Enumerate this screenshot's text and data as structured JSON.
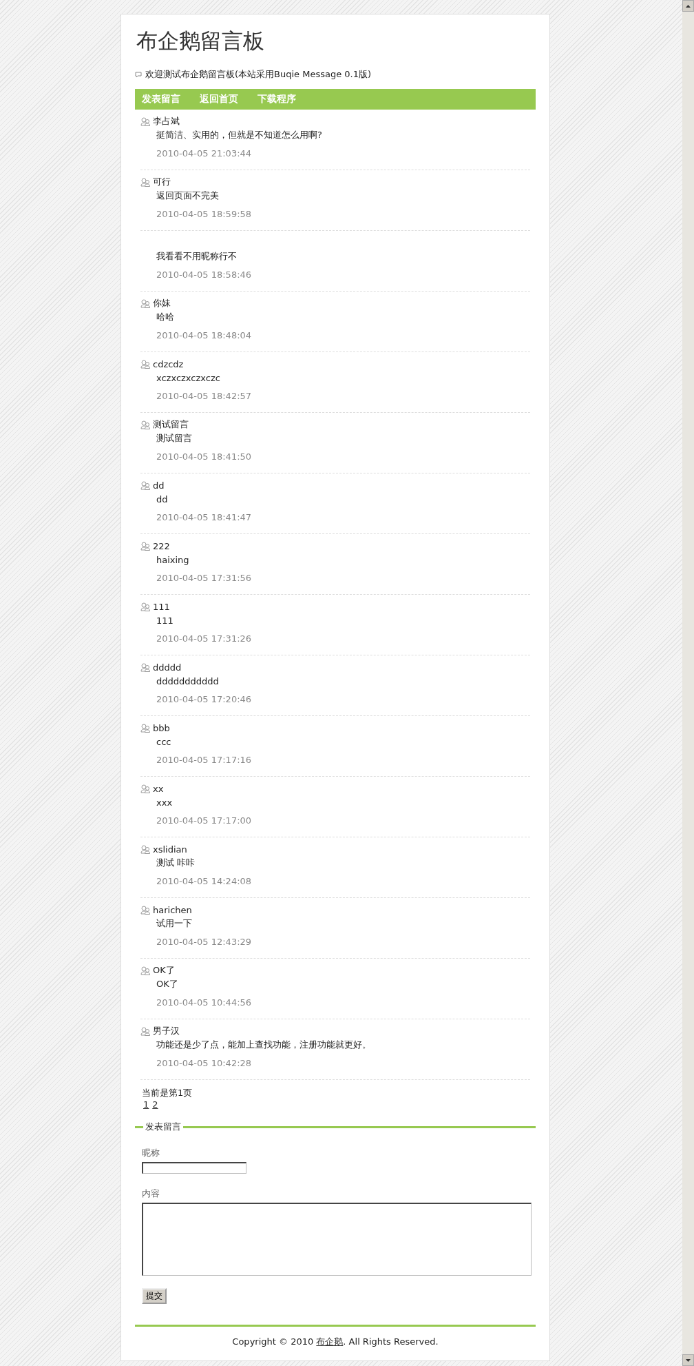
{
  "header": {
    "title": "布企鹅留言板",
    "welcome": "欢迎测试布企鹅留言板(本站采用Buqie Message 0.1版)"
  },
  "nav": [
    "发表留言",
    "返回首页",
    "下载程序"
  ],
  "messages": [
    {
      "name": "李占斌",
      "content": "挺简洁、实用的，但就是不知道怎么用啊?",
      "time": "2010-04-05 21:03:44"
    },
    {
      "name": "可行",
      "content": "返回页面不完美",
      "time": "2010-04-05 18:59:58"
    },
    {
      "content": "我看看不用昵称行不",
      "time": "2010-04-05 18:58:46"
    },
    {
      "name": "你妹",
      "content": "哈哈",
      "time": "2010-04-05 18:48:04"
    },
    {
      "name": "cdzcdz",
      "content": "xczxczxczxczc",
      "time": "2010-04-05 18:42:57"
    },
    {
      "name": "测试留言",
      "content": "测试留言",
      "time": "2010-04-05 18:41:50"
    },
    {
      "name": "dd",
      "content": "dd",
      "time": "2010-04-05 18:41:47"
    },
    {
      "name": "222",
      "content": "haixing",
      "time": "2010-04-05 17:31:56"
    },
    {
      "name": "111",
      "content": "111",
      "time": "2010-04-05 17:31:26"
    },
    {
      "name": "ddddd",
      "content": "ddddddddddd",
      "time": "2010-04-05 17:20:46"
    },
    {
      "name": "bbb",
      "content": "ccc",
      "time": "2010-04-05 17:17:16"
    },
    {
      "name": "xx",
      "content": "xxx",
      "time": "2010-04-05 17:17:00"
    },
    {
      "name": "xslidian",
      "content": "测试 咔咔",
      "time": "2010-04-05 14:24:08"
    },
    {
      "name": "harichen",
      "content": "试用一下",
      "time": "2010-04-05 12:43:29"
    },
    {
      "name": "OK了",
      "content": "OK了",
      "time": "2010-04-05 10:44:56"
    },
    {
      "name": "男子汉",
      "content": "功能还是少了点，能加上查找功能，注册功能就更好。",
      "time": "2010-04-05 10:42:28"
    }
  ],
  "pagination": {
    "current": "当前是第1页",
    "pages": [
      "1",
      "2"
    ]
  },
  "form": {
    "legend": "发表留言",
    "nickname_label": "昵称",
    "content_label": "内容",
    "submit": "提交"
  },
  "footer": {
    "before": "Copyright © 2010 ",
    "link": "布企鹅",
    "after": ". All Rights Reserved."
  }
}
